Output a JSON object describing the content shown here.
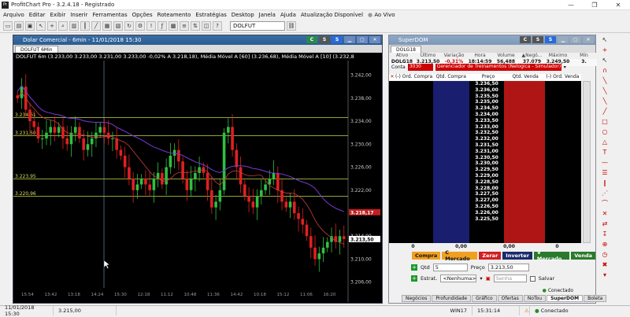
{
  "window": {
    "title": "ProfitChart Pro - 3.2.4.18 - Registrado",
    "logo": "Pr"
  },
  "menu": [
    "Arquivo",
    "Editar",
    "Exibir",
    "Inserir",
    "Ferramentas",
    "Opções",
    "Roteamento",
    "Estratégias",
    "Desktop",
    "Janela",
    "Ajuda",
    "Atualização Disponível"
  ],
  "menu_aovivo": "Ao Vivo",
  "toolbar": {
    "ticker": "DOLFUT"
  },
  "chart_window": {
    "title": "Dolar Comercial - 6min - 11/01/2018 15:30",
    "tab": "DOLFUT 6Min",
    "legend": "DOLFUT 6m (3.233,00  3.233,00  3.231,00  3.233,00  -0,02%  A 3.218,18), Média Móvel A [60] (3.236,68), Média Móvel A [10] (3.232,8"
  },
  "chart_data": {
    "type": "candlestick",
    "title": "Dolar Comercial - 6min - 11/01/2018 15:30",
    "y_ticks": [
      "3.242,00",
      "3.238,00",
      "3.234,00",
      "3.230,00",
      "3.226,00",
      "3.222,00",
      "3.218,00",
      "3.214,00",
      "3.210,00",
      "3.206,00"
    ],
    "ylim": [
      3205,
      3244
    ],
    "levels": [
      {
        "label": "3.234,61",
        "value": 3234.61
      },
      {
        "label": "3.231,50",
        "value": 3231.5
      },
      {
        "label": "3.223,95",
        "value": 3223.95
      },
      {
        "label": "3.220,96",
        "value": 3220.96
      }
    ],
    "price_tags": [
      {
        "label": "3.218,17",
        "value": 3218.17,
        "color": "#c02020"
      },
      {
        "label": "3.213,50",
        "value": 3213.5,
        "color": "#ffffff"
      }
    ],
    "x_labels": [
      "15:54",
      "13:42",
      "13:18",
      "14:24",
      "15:30",
      "12:18",
      "11:12",
      "10:48",
      "11:36",
      "14:42",
      "10:18",
      "15:12",
      "11:06",
      "16:20"
    ],
    "closes": [
      3238,
      3240,
      3236,
      3234,
      3233,
      3231,
      3231,
      3232,
      3233,
      3232,
      3233,
      3231,
      3230,
      3232,
      3233,
      3231,
      3229,
      3230,
      3231,
      3232,
      3233,
      3232,
      3231,
      3231,
      3229,
      3228,
      3226,
      3224,
      3222,
      3223,
      3224,
      3223,
      3222,
      3224,
      3225,
      3223,
      3226,
      3228,
      3229,
      3227,
      3224,
      3222,
      3224,
      3225,
      3226,
      3225,
      3222,
      3219,
      3220,
      3222,
      3232,
      3233,
      3229,
      3226,
      3223,
      3221,
      3220,
      3219,
      3221,
      3222,
      3223,
      3224,
      3225,
      3222,
      3220,
      3219,
      3220,
      3218,
      3217,
      3216,
      3214,
      3212,
      3210,
      3211,
      3212,
      3213,
      3214,
      3213,
      3214,
      3213.5
    ],
    "series": [
      {
        "name": "Média Móvel A [60]",
        "color": "#7a3ad8"
      },
      {
        "name": "Média Móvel A [10]",
        "color": "#c84040"
      }
    ]
  },
  "superdom": {
    "title": "SuperDOM",
    "tab": "DOLG18",
    "header": [
      "Ativo",
      "Último",
      "Variação",
      "Hora",
      "Volume",
      "▲Negó...",
      "Máximo",
      "Mín"
    ],
    "row": [
      "DOLG18",
      "3.213,50",
      "-0,31%",
      "18:14:59",
      "56,488",
      "37.079",
      "3.249,50",
      "3."
    ],
    "conta_label": "Conta",
    "conta_num": "3030",
    "conta_desc": "Gerenciador de Treinamentos (Nelogica - Simulador)",
    "book_head": [
      "(-) Ord. Compra",
      "Qtd. Compra",
      "Preço",
      "Qtd. Venda",
      "(-) Ord. Venda"
    ],
    "prices": [
      "3.236,50",
      "3.236,00",
      "3.235,50",
      "3.235,00",
      "3.234,50",
      "3.234,00",
      "3.233,50",
      "3.233,00",
      "3.232,50",
      "3.232,00",
      "3.231,50",
      "3.231,00",
      "3.230,50",
      "3.230,00",
      "3.229,50",
      "3.229,00",
      "3.228,50",
      "3.228,00",
      "3.227,50",
      "3.227,00",
      "3.226,50",
      "3.226,00",
      "3.225,50"
    ],
    "totals": [
      "0",
      "0,00",
      "0,00",
      "0"
    ],
    "buttons": {
      "compra": "Compra",
      "cmercado": "C Mercado",
      "zerar": "Zerar",
      "inverter": "Inverter",
      "vmercado": "V Mercado",
      "venda": "Venda"
    },
    "qtd_label": "Qtd",
    "qtd_value": "5",
    "preco_label": "Preço",
    "preco_value": "3.213,50",
    "estrat_label": "Estrat.",
    "estrat_value": "<Nenhuma>",
    "senha_placeholder": "Senha",
    "salvar_label": "Salvar",
    "status": "Conectado",
    "tabs": [
      "Negócios",
      "Profundidade",
      "Gráfico",
      "Ofertas",
      "NoTou",
      "SuperDOM",
      "Boleta"
    ]
  },
  "statusbar": {
    "datetime": "11/01/2018 15:30",
    "price": "3.215,00",
    "symbol": "WIN17",
    "clock": "15:31:14",
    "connection": "Conectado"
  }
}
